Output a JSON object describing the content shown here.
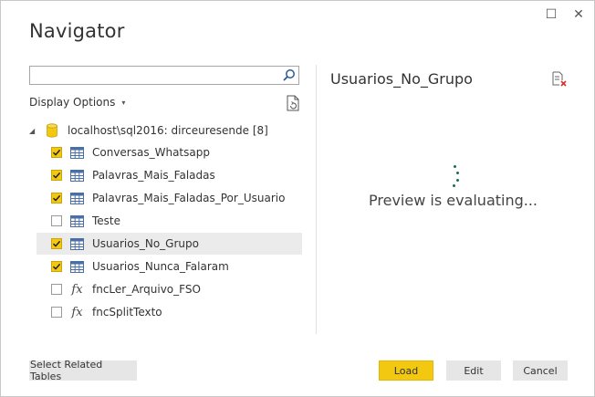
{
  "window": {
    "title": "Navigator",
    "maximize_glyph": "☐",
    "close_glyph": "✕"
  },
  "search": {
    "value": "",
    "placeholder": ""
  },
  "display_options": {
    "label": "Display Options",
    "caret": "▾"
  },
  "tree": {
    "root": {
      "label": "localhost\\sql2016: dirceuresende [8]",
      "expander": "◢"
    },
    "items": [
      {
        "label": "Conversas_Whatsapp",
        "checked": true,
        "kind": "table",
        "selected": false
      },
      {
        "label": "Palavras_Mais_Faladas",
        "checked": true,
        "kind": "table",
        "selected": false
      },
      {
        "label": "Palavras_Mais_Faladas_Por_Usuario",
        "checked": true,
        "kind": "table",
        "selected": false
      },
      {
        "label": "Teste",
        "checked": false,
        "kind": "table",
        "selected": false
      },
      {
        "label": "Usuarios_No_Grupo",
        "checked": true,
        "kind": "table",
        "selected": true
      },
      {
        "label": "Usuarios_Nunca_Falaram",
        "checked": true,
        "kind": "table",
        "selected": false
      },
      {
        "label": "fncLer_Arquivo_FSO",
        "checked": false,
        "kind": "function",
        "selected": false
      },
      {
        "label": "fncSplitTexto",
        "checked": false,
        "kind": "function",
        "selected": false
      }
    ]
  },
  "preview": {
    "title": "Usuarios_No_Grupo",
    "status": "Preview is evaluating..."
  },
  "footer": {
    "select_related": "Select Related Tables",
    "load": "Load",
    "edit": "Edit",
    "cancel": "Cancel"
  },
  "colors": {
    "accent": "#f2c811",
    "selected_row": "#ebebeb",
    "spinner": "#1f6b56"
  },
  "icons": {
    "search": "search-icon",
    "refresh": "refresh-icon",
    "database": "database-icon",
    "table": "table-icon",
    "function": "function-icon",
    "preview_action": "preview-options-icon"
  }
}
